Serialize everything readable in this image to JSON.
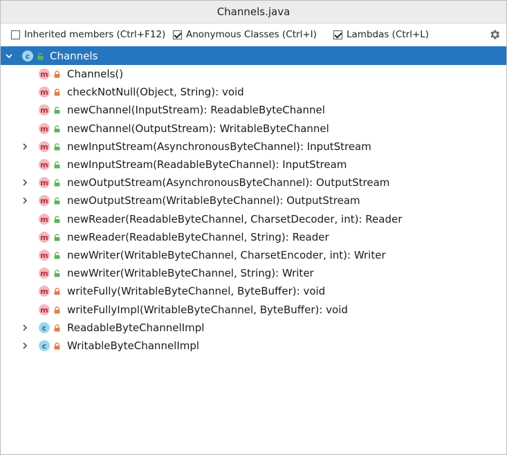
{
  "window": {
    "title": "Channels.java"
  },
  "toolbar": {
    "options": [
      {
        "label": "Inherited members (Ctrl+F12)",
        "checked": false
      },
      {
        "label": "Anonymous Classes (Ctrl+I)",
        "checked": true
      },
      {
        "label": "Lambdas (Ctrl+L)",
        "checked": true
      }
    ],
    "settings_icon": "gear-icon"
  },
  "colors": {
    "selection": "#2675bf",
    "method_icon": "#f4b8be",
    "method_letter": "#b3303f",
    "class_icon": "#9fd6ee",
    "class_letter": "#2a6f96",
    "lock_private": "#e0804a",
    "lock_public": "#5fb35a"
  },
  "tree": {
    "root": {
      "label": "Channels",
      "kind": "class",
      "access": "public",
      "expanded": true,
      "selected": true
    },
    "items": [
      {
        "label": "Channels()",
        "kind": "method",
        "access": "private",
        "expandable": false
      },
      {
        "label": "checkNotNull(Object, String): void",
        "kind": "method",
        "access": "private",
        "expandable": false
      },
      {
        "label": "newChannel(InputStream): ReadableByteChannel",
        "kind": "method",
        "access": "public",
        "expandable": false
      },
      {
        "label": "newChannel(OutputStream): WritableByteChannel",
        "kind": "method",
        "access": "public",
        "expandable": false
      },
      {
        "label": "newInputStream(AsynchronousByteChannel): InputStream",
        "kind": "method",
        "access": "public",
        "expandable": true
      },
      {
        "label": "newInputStream(ReadableByteChannel): InputStream",
        "kind": "method",
        "access": "public",
        "expandable": false
      },
      {
        "label": "newOutputStream(AsynchronousByteChannel): OutputStream",
        "kind": "method",
        "access": "public",
        "expandable": true
      },
      {
        "label": "newOutputStream(WritableByteChannel): OutputStream",
        "kind": "method",
        "access": "public",
        "expandable": true
      },
      {
        "label": "newReader(ReadableByteChannel, CharsetDecoder, int): Reader",
        "kind": "method",
        "access": "public",
        "expandable": false
      },
      {
        "label": "newReader(ReadableByteChannel, String): Reader",
        "kind": "method",
        "access": "public",
        "expandable": false
      },
      {
        "label": "newWriter(WritableByteChannel, CharsetEncoder, int): Writer",
        "kind": "method",
        "access": "public",
        "expandable": false
      },
      {
        "label": "newWriter(WritableByteChannel, String): Writer",
        "kind": "method",
        "access": "public",
        "expandable": false
      },
      {
        "label": "writeFully(WritableByteChannel, ByteBuffer): void",
        "kind": "method",
        "access": "private",
        "expandable": false
      },
      {
        "label": "writeFullyImpl(WritableByteChannel, ByteBuffer): void",
        "kind": "method",
        "access": "private",
        "expandable": false
      },
      {
        "label": "ReadableByteChannelImpl",
        "kind": "class",
        "access": "private",
        "expandable": true
      },
      {
        "label": "WritableByteChannelImpl",
        "kind": "class",
        "access": "private",
        "expandable": true
      }
    ]
  }
}
